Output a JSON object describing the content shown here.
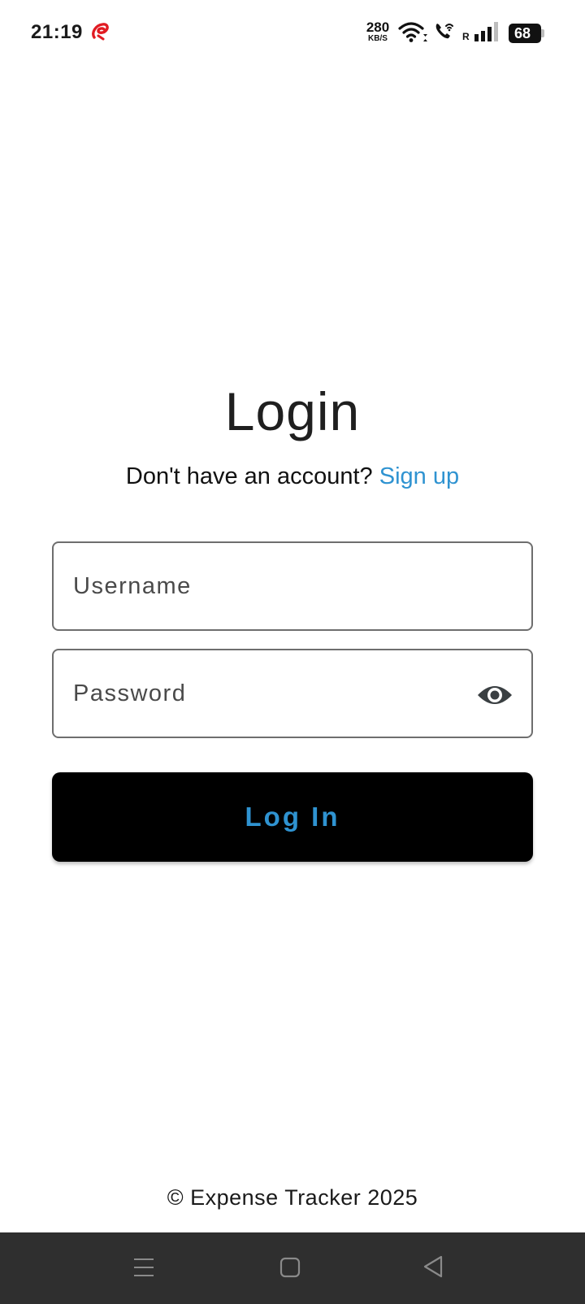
{
  "status_bar": {
    "time": "21:19",
    "net_speed_value": "280",
    "net_speed_unit": "KB/S",
    "roaming": "R",
    "battery": "68",
    "icons": [
      "airtel-carrier-icon",
      "wifi-icon",
      "wifi-call-icon",
      "signal-icon",
      "battery-icon"
    ],
    "carrier_color": "#e11b22"
  },
  "login": {
    "title": "Login",
    "signup_prompt": "Don't have an account?",
    "signup_link": "Sign up",
    "username_placeholder": "Username",
    "password_placeholder": "Password",
    "password_toggle_icon": "eye-icon",
    "submit_label": "Log In"
  },
  "footer": {
    "text": "© Expense Tracker 2025"
  },
  "nav_bar": {
    "buttons": [
      "menu-icon",
      "home-icon",
      "back-icon"
    ]
  },
  "colors": {
    "accent": "#2f93d1",
    "button_bg": "#000000",
    "field_border": "#6e6e6e",
    "nav_bg": "#2f2f2f"
  }
}
